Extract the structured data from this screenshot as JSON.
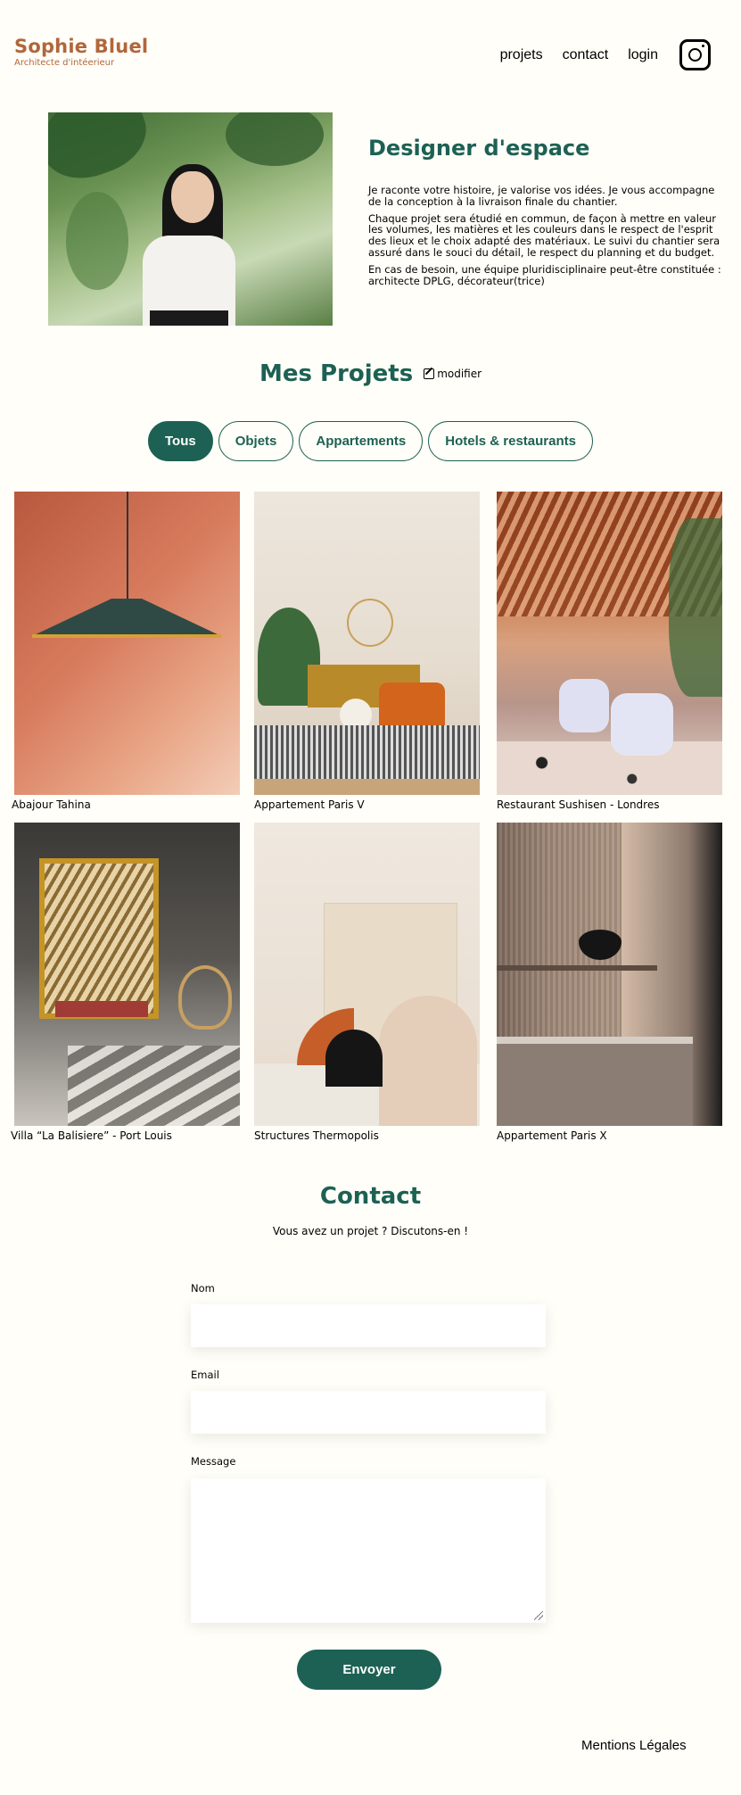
{
  "header": {
    "logo_title": "Sophie Bluel",
    "logo_subtitle": "Architecte d'intéerieur",
    "nav": {
      "projets": "projets",
      "contact": "contact",
      "login": "login"
    },
    "instagram_icon": "instagram-icon"
  },
  "intro": {
    "title": "Designer d'espace",
    "paragraphs": [
      "Je raconte votre histoire, je valorise vos idées. Je vous accompagne de la conception à la livraison finale du chantier.",
      "Chaque projet sera étudié en commun, de façon à mettre en valeur les volumes, les matières et les couleurs dans le respect de l'esprit des lieux et le choix adapté des matériaux. Le suivi du chantier sera assuré dans le souci du détail, le respect du planning et du budget.",
      "En cas de besoin, une équipe pluridisciplinaire peut-être constituée : architecte DPLG, décorateur(trice)"
    ]
  },
  "projects": {
    "title": "Mes Projets",
    "modifier_label": "modifier",
    "filters": [
      "Tous",
      "Objets",
      "Appartements",
      "Hotels & restaurants"
    ],
    "active_filter": "Tous",
    "items": [
      {
        "caption": "Abajour Tahina"
      },
      {
        "caption": "Appartement Paris V"
      },
      {
        "caption": "Restaurant Sushisen - Londres"
      },
      {
        "caption": "Villa “La Balisiere” - Port Louis"
      },
      {
        "caption": "Structures Thermopolis"
      },
      {
        "caption": "Appartement Paris X"
      }
    ]
  },
  "contact": {
    "title": "Contact",
    "subtitle": "Vous avez un projet ? Discutons-en !",
    "fields": {
      "name_label": "Nom",
      "email_label": "Email",
      "message_label": "Message"
    },
    "submit_label": "Envoyer"
  },
  "footer": {
    "legal": "Mentions Légales"
  },
  "colors": {
    "primary": "#1d6154",
    "brand": "#b1663c",
    "background": "#fffef8"
  }
}
